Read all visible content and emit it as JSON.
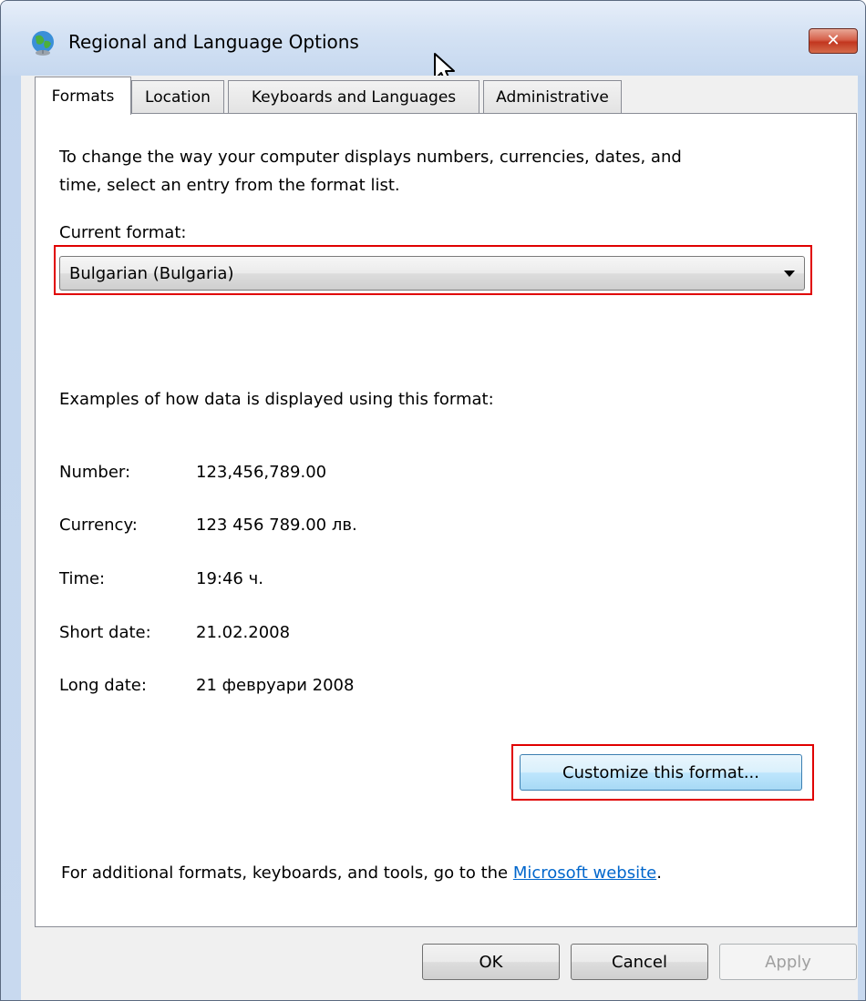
{
  "window": {
    "title": "Regional and Language Options"
  },
  "tabs": [
    {
      "label": "Formats",
      "active": true
    },
    {
      "label": "Location",
      "active": false
    },
    {
      "label": "Keyboards and Languages",
      "active": false
    },
    {
      "label": "Administrative",
      "active": false
    }
  ],
  "formats": {
    "intro_line1": "To change the way your computer displays numbers, currencies, dates, and",
    "intro_line2": "time, select an entry from the format list.",
    "current_format_label": "Current format:",
    "current_format_value": "Bulgarian (Bulgaria)",
    "examples_heading": "Examples of how data is displayed using this format:",
    "examples": [
      {
        "label": "Number:",
        "value": "123,456,789.00"
      },
      {
        "label": "Currency:",
        "value": "123 456 789.00 лв."
      },
      {
        "label": "Time:",
        "value": "19:46 ч."
      },
      {
        "label": "Short date:",
        "value": "21.02.2008"
      },
      {
        "label": "Long date:",
        "value": "21 февруари 2008"
      }
    ],
    "customize_button": "Customize this format...",
    "footer_prefix": "For additional formats, keyboards, and tools, go to the ",
    "footer_link": "Microsoft website",
    "footer_suffix": "."
  },
  "buttons": {
    "ok": "OK",
    "cancel": "Cancel",
    "apply": "Apply"
  },
  "colors": {
    "highlight": "#e00000",
    "link": "#0066cc",
    "close": "#c2361f"
  },
  "icons": [
    "globe-icon",
    "close-icon",
    "chevron-down-icon",
    "mouse-cursor-icon"
  ]
}
